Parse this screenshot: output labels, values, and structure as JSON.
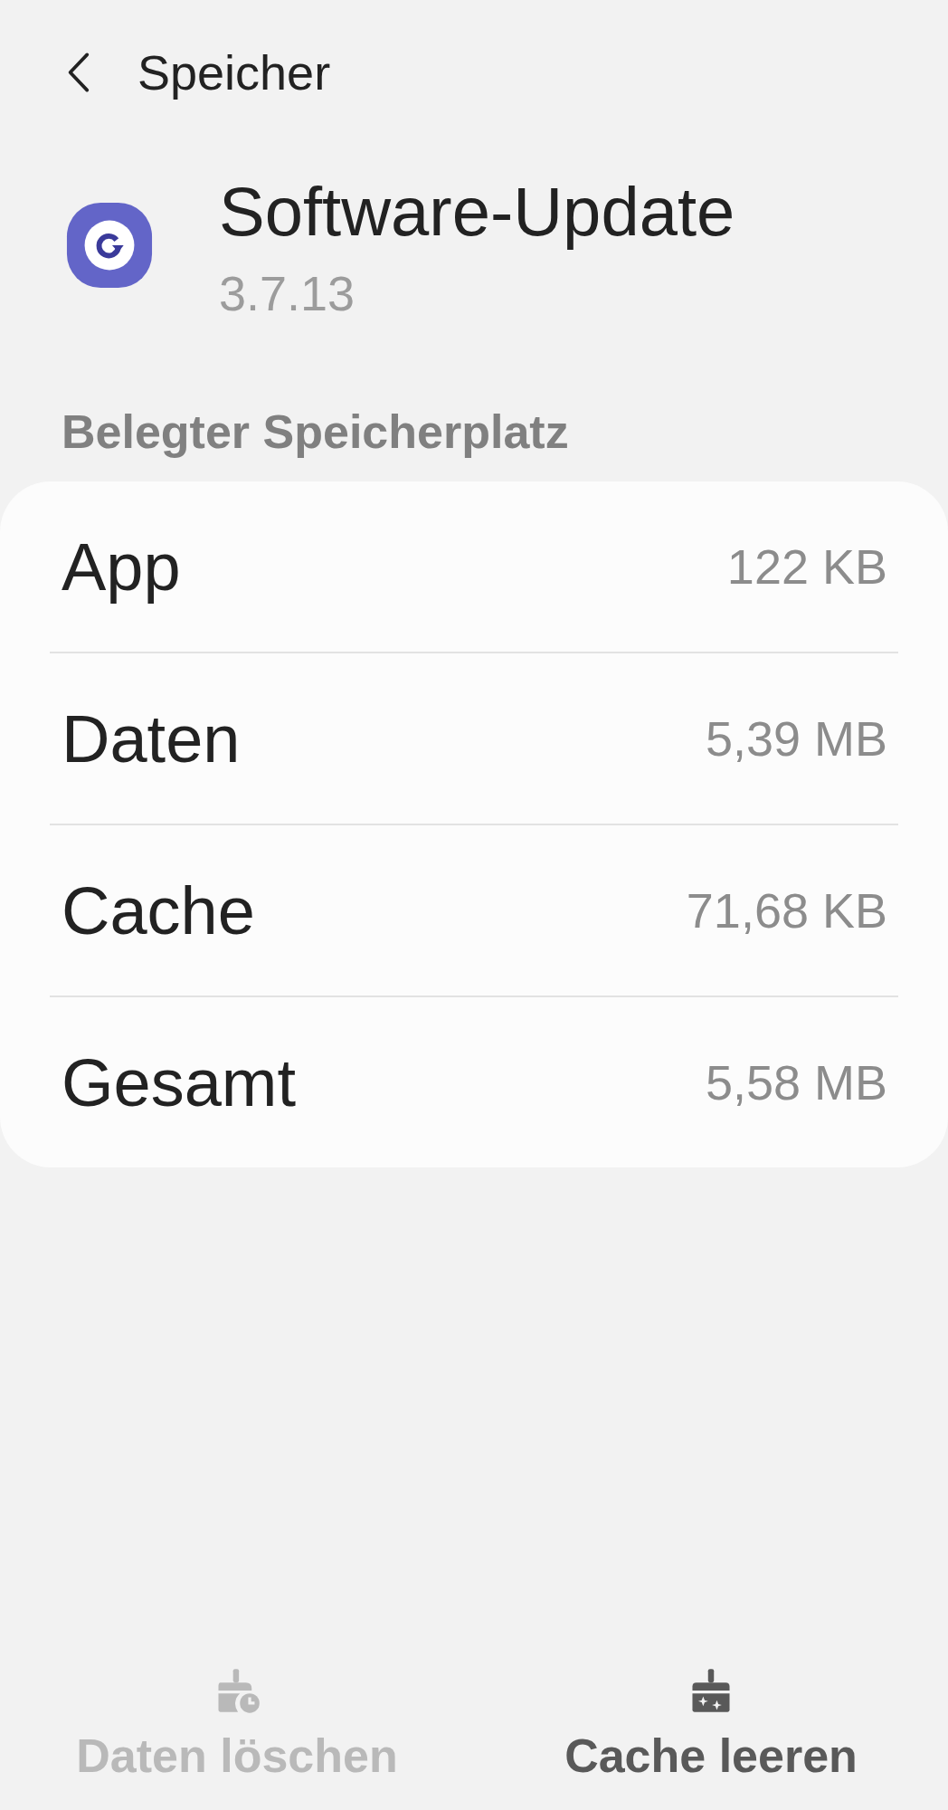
{
  "header": {
    "title": "Speicher"
  },
  "app": {
    "name": "Software-Update",
    "version": "3.7.13"
  },
  "section_title": "Belegter Speicherplatz",
  "storage_rows": [
    {
      "label": "App",
      "value": "122 KB"
    },
    {
      "label": "Daten",
      "value": "5,39 MB"
    },
    {
      "label": "Cache",
      "value": "71,68 KB"
    },
    {
      "label": "Gesamt",
      "value": "5,58 MB"
    }
  ],
  "actions": [
    {
      "kind": "clear-data",
      "label": "Daten löschen",
      "disabled": true
    },
    {
      "kind": "clear-cache",
      "label": "Cache leeren",
      "disabled": false
    }
  ]
}
